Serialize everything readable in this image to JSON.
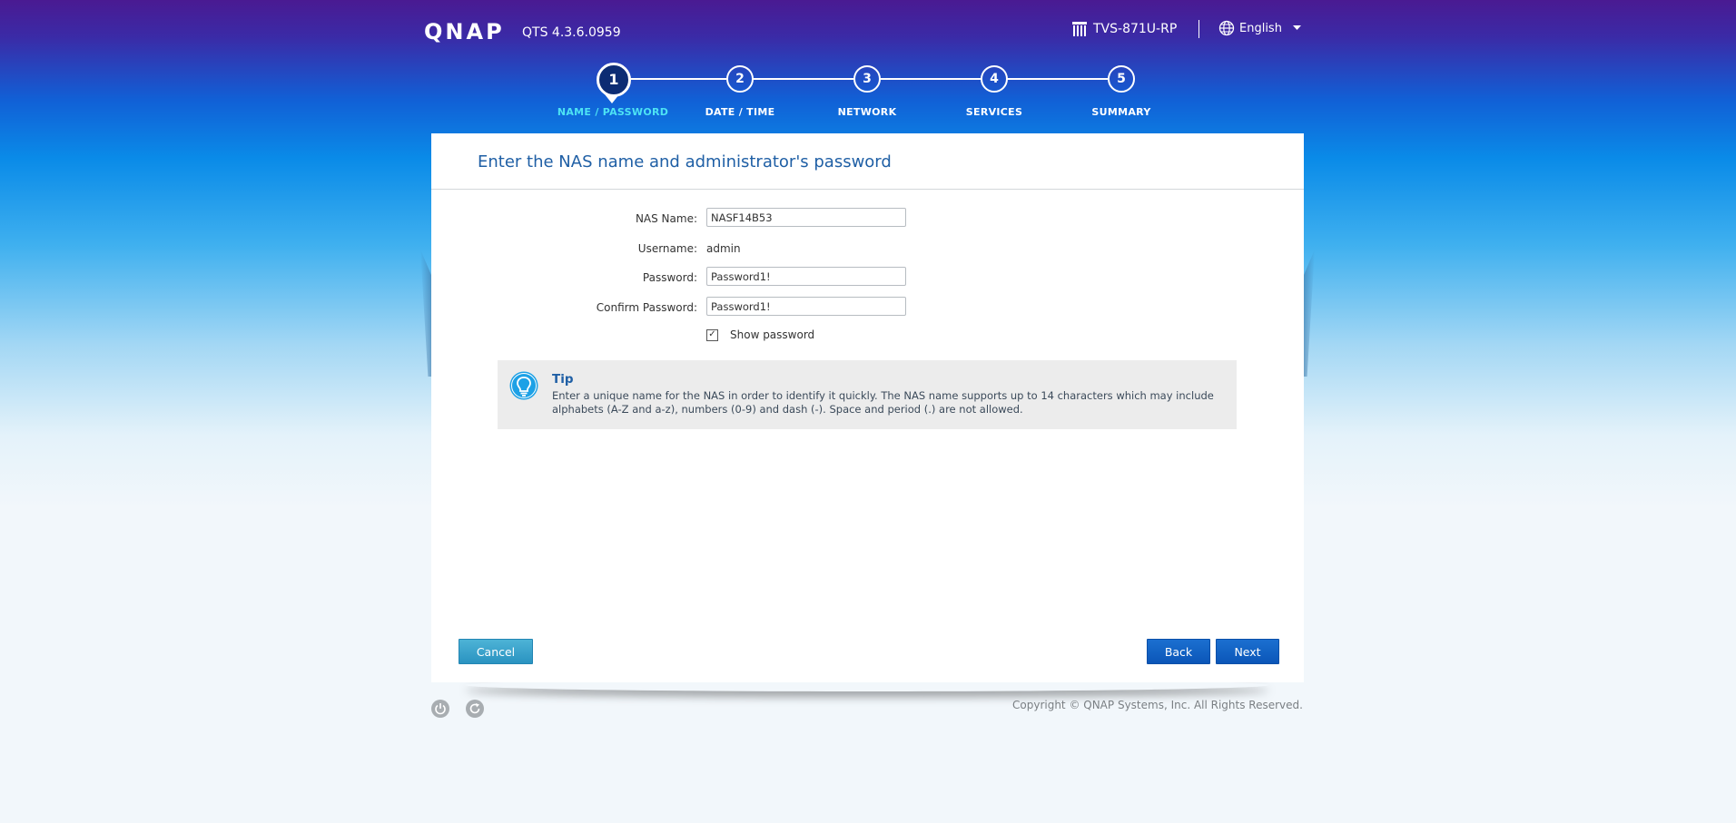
{
  "header": {
    "logo": "QNAP",
    "version": "QTS 4.3.6.0959",
    "model": "TVS-871U-RP",
    "language": "English"
  },
  "steps": [
    {
      "number": "1",
      "label": "NAME / PASSWORD",
      "active": true
    },
    {
      "number": "2",
      "label": "DATE / TIME",
      "active": false
    },
    {
      "number": "3",
      "label": "NETWORK",
      "active": false
    },
    {
      "number": "4",
      "label": "SERVICES",
      "active": false
    },
    {
      "number": "5",
      "label": "SUMMARY",
      "active": false
    }
  ],
  "panel": {
    "title": "Enter the NAS name and administrator's password",
    "form": {
      "nas_name_label": "NAS Name:",
      "nas_name_value": "NASF14B53",
      "username_label": "Username:",
      "username_value": "admin",
      "password_label": "Password:",
      "password_value": "Password1!",
      "confirm_label": "Confirm Password:",
      "confirm_value": "Password1!",
      "show_password_label": "Show password",
      "show_password_checked": true
    },
    "tip": {
      "title": "Tip",
      "text": "Enter a unique name for the NAS in order to identify it quickly. The NAS name supports up to 14 characters which may include alphabets (A-Z and a-z), numbers (0-9) and dash (-). Space and period (.) are not allowed."
    },
    "buttons": {
      "cancel": "Cancel",
      "back": "Back",
      "next": "Next"
    }
  },
  "footer": {
    "copyright": "Copyright © QNAP Systems, Inc. All Rights Reserved."
  },
  "colors": {
    "accent": "#1f5fa5",
    "active_step": "#4de3f4",
    "primary_button": "#0b56b8",
    "cancel_button": "#2a93c1"
  }
}
